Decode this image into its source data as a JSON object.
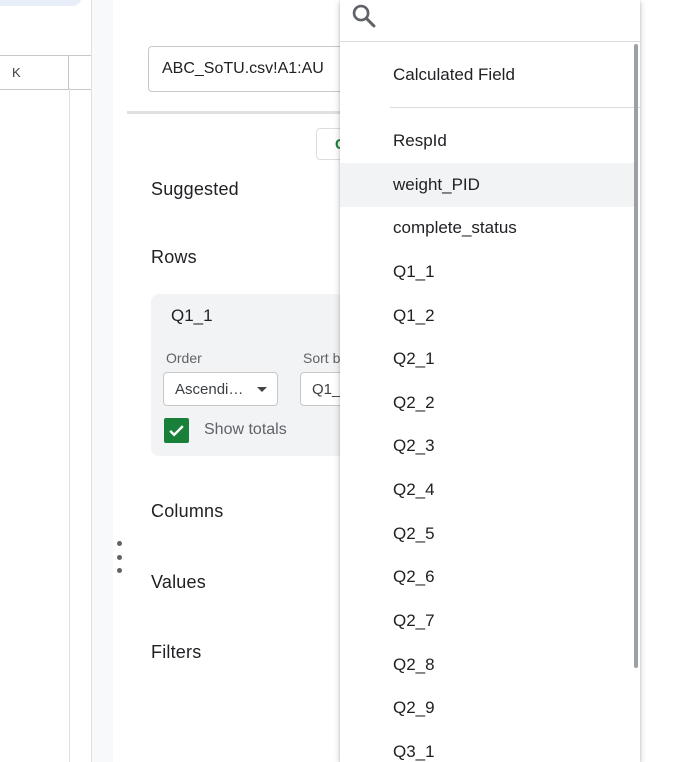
{
  "sheet": {
    "column_header": "K"
  },
  "panel": {
    "data_range": "ABC_SoTU.csv!A1:AU",
    "suggested_button": "G",
    "suggested_label": "Suggested",
    "rows_label": "Rows",
    "row_card": {
      "title": "Q1_1",
      "order_label": "Order",
      "order_value": "Ascendi…",
      "sort_by_label": "Sort b",
      "sort_by_value": "Q1_",
      "show_totals_label": "Show totals",
      "show_totals_checked": true
    },
    "columns_label": "Columns",
    "values_label": "Values",
    "filters_label": "Filters"
  },
  "dropdown": {
    "search_placeholder": "",
    "calculated_field": "Calculated Field",
    "highlighted_item": "weight_PID",
    "items": [
      "RespId",
      "weight_PID",
      "complete_status",
      "Q1_1",
      "Q1_2",
      "Q2_1",
      "Q2_2",
      "Q2_3",
      "Q2_4",
      "Q2_5",
      "Q2_6",
      "Q2_7",
      "Q2_8",
      "Q2_9",
      "Q3_1"
    ]
  },
  "colors": {
    "accent_green": "#188038",
    "highlight": "#f1f3f4"
  }
}
